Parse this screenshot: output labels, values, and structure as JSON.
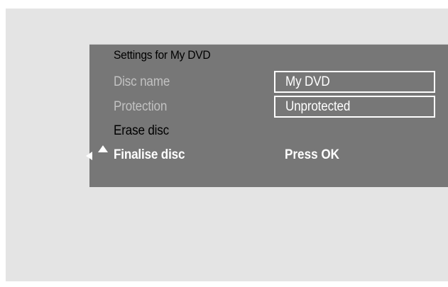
{
  "menu": {
    "title": "Settings for My DVD",
    "rows": [
      {
        "label": "Disc name",
        "value": "My DVD",
        "state": "disabled"
      },
      {
        "label": "Protection",
        "value": "Unprotected",
        "state": "disabled"
      },
      {
        "label": "Erase disc",
        "value": "",
        "state": "normal"
      },
      {
        "label": "Finalise disc",
        "value": "Press OK",
        "state": "selected"
      }
    ]
  },
  "colors": {
    "background": "#e4e4e4",
    "panel": "#777777",
    "disabled_text": "#c2c2c2",
    "selected_text": "#ffffff"
  },
  "icons": {
    "cursor_left": "triangle-left-icon",
    "cursor_up": "triangle-up-icon"
  }
}
